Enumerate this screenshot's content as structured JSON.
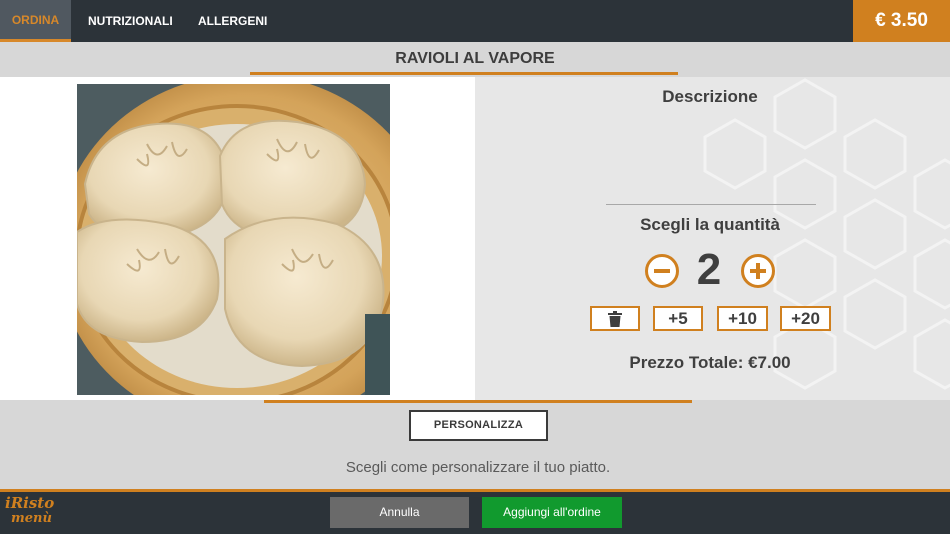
{
  "header": {
    "tabs": [
      {
        "label": "ORDINA",
        "active": true
      },
      {
        "label": "NUTRIZIONALI",
        "active": false
      },
      {
        "label": "ALLERGENI",
        "active": false
      }
    ],
    "price": "€ 3.50"
  },
  "dish": {
    "title": "RAVIOLI AL VAPORE",
    "image_icon": "dumplings-photo"
  },
  "details": {
    "description_title": "Descrizione",
    "quantity_title": "Scegli la quantità",
    "quantity": "2",
    "quick_add": [
      "+5",
      "+10",
      "+20"
    ],
    "total": "Prezzo Totale: €7.00"
  },
  "customize": {
    "button_label": "PERSONALIZZA",
    "hint": "Scegli come personalizzare il tuo piatto."
  },
  "footer": {
    "logo_line1": "iRisto",
    "logo_line2": "menù",
    "cancel_label": "Annulla",
    "add_label": "Aggiungi all'ordine"
  },
  "colors": {
    "accent": "#d0801f",
    "dark_bar": "#2c3339",
    "confirm": "#119a2e",
    "cancel": "#6a6a6a"
  }
}
